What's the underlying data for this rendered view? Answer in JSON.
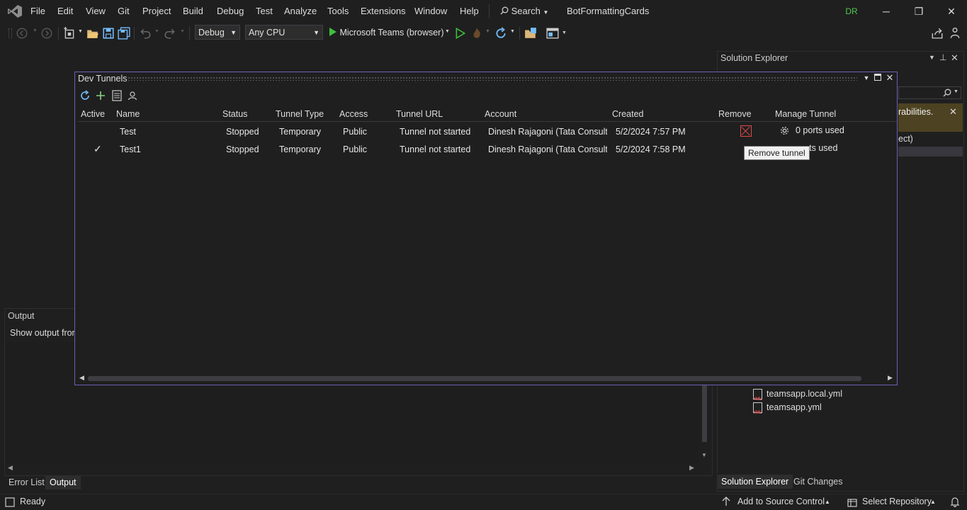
{
  "menu": [
    "File",
    "Edit",
    "View",
    "Git",
    "Project",
    "Build",
    "Debug",
    "Test",
    "Analyze",
    "Tools",
    "Extensions",
    "Window",
    "Help"
  ],
  "search_label": "Search",
  "solution_name": "BotFormattingCards",
  "avatar_initials": "DR",
  "toolbar": {
    "config": "Debug",
    "platform": "Any CPU",
    "run_target": "Microsoft Teams (browser)"
  },
  "solution_explorer": {
    "title": "Solution Explorer",
    "warning_text": "rabilities.",
    "project_fragment": "ect)",
    "files": [
      "teamsapp.local.yml",
      "teamsapp.yml"
    ],
    "file_icon_text": "YML",
    "tabs": [
      "Solution Explorer",
      "Git Changes"
    ]
  },
  "output": {
    "title": "Output",
    "show_output_from": "Show output fror",
    "tabs": [
      "Error List",
      "Output"
    ]
  },
  "statusbar": {
    "ready": "Ready",
    "add_source": "Add to Source Control",
    "select_repo": "Select Repository"
  },
  "dev_tunnels": {
    "title": "Dev Tunnels",
    "columns": [
      "Active",
      "Name",
      "Status",
      "Tunnel Type",
      "Access",
      "Tunnel URL",
      "Account",
      "Created",
      "Remove",
      "Manage Tunnel"
    ],
    "rows": [
      {
        "active": "",
        "name": "Test",
        "status": "Stopped",
        "type": "Temporary",
        "access": "Public",
        "url": "Tunnel not started",
        "account": "Dinesh Rajagoni (Tata Consultar",
        "created": "5/2/2024 7:57 PM",
        "ports": "0 ports used"
      },
      {
        "active": "✓",
        "name": "Test1",
        "status": "Stopped",
        "type": "Temporary",
        "access": "Public",
        "url": "Tunnel not started",
        "account": "Dinesh Rajagoni (Tata Consultar",
        "created": "5/2/2024 7:58 PM",
        "ports": "rts used"
      }
    ],
    "tooltip": "Remove tunnel"
  },
  "colors": {
    "accent": "#6b5fb5",
    "remove": "#e04a4a",
    "run": "#3fbf3f"
  }
}
